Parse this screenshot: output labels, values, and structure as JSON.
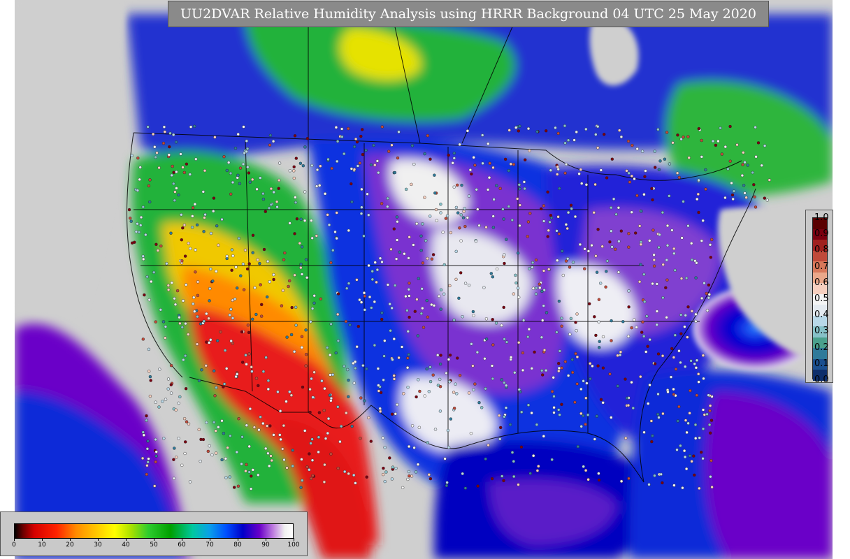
{
  "title": "UU2DVAR Relative Humidity Analysis using HRRR Background 04 UTC 25 May 2020",
  "map": {
    "region": "North America (CONUS domain)",
    "field": "relative humidity",
    "water_color": "#cfcfcf",
    "moist_color": "#4b3aa8",
    "dry_color": "#e81c1c"
  },
  "rh_colorbar": {
    "ticks": [
      "0",
      "10",
      "20",
      "30",
      "40",
      "50",
      "60",
      "70",
      "80",
      "90",
      "100"
    ],
    "range": [
      0,
      100
    ],
    "stops": [
      {
        "v": 0,
        "c": "#000000"
      },
      {
        "v": 3,
        "c": "#6b0000"
      },
      {
        "v": 7,
        "c": "#d40000"
      },
      {
        "v": 15,
        "c": "#ff2200"
      },
      {
        "v": 22,
        "c": "#ff8a00"
      },
      {
        "v": 30,
        "c": "#ffcc00"
      },
      {
        "v": 36,
        "c": "#ffff00"
      },
      {
        "v": 42,
        "c": "#a6e000"
      },
      {
        "v": 48,
        "c": "#2ecc2e"
      },
      {
        "v": 56,
        "c": "#00a000"
      },
      {
        "v": 64,
        "c": "#00c8a0"
      },
      {
        "v": 70,
        "c": "#0aa0e8"
      },
      {
        "v": 76,
        "c": "#0050ff"
      },
      {
        "v": 82,
        "c": "#0000c8"
      },
      {
        "v": 88,
        "c": "#6a00c8"
      },
      {
        "v": 93,
        "c": "#c080e0"
      },
      {
        "v": 97,
        "c": "#f0f0f0"
      },
      {
        "v": 100,
        "c": "#ffffff"
      }
    ]
  },
  "obs_legend": {
    "ticks": [
      "1.0",
      "0.9",
      "0.8",
      "0.7",
      "0.6",
      "0.5",
      "0.4",
      "0.3",
      "0.2",
      "0.1",
      "0.0"
    ],
    "colors": [
      "#0d2e6b",
      "#1a4f8f",
      "#2f7a9a",
      "#4aa08c",
      "#86c1c8",
      "#b8d8e8",
      "#e4eaf0",
      "#f4f4f4",
      "#f6cfbf",
      "#eaa88a",
      "#d7785a",
      "#c04a3a",
      "#a0201e",
      "#7a0010",
      "#5a0000"
    ]
  }
}
